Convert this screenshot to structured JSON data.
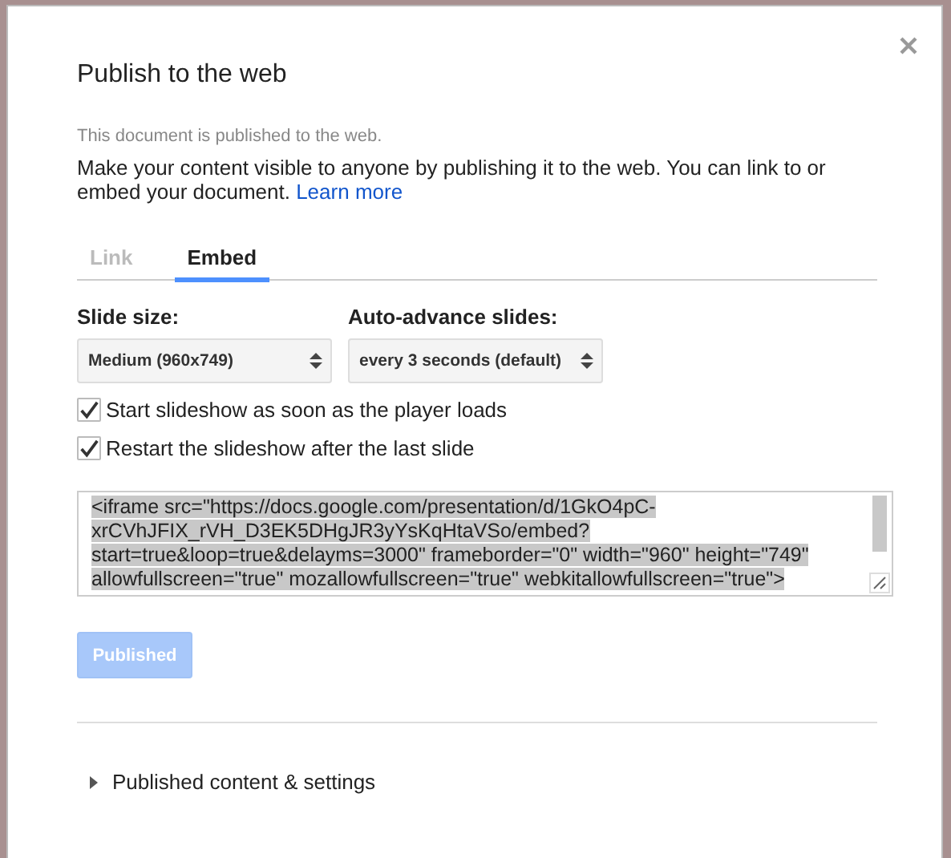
{
  "dialog": {
    "title": "Publish to the web",
    "status": "This document is published to the web.",
    "description": "Make your content visible to anyone by publishing it to the web. You can link to or embed your document.",
    "learn_more": "Learn more"
  },
  "tabs": [
    {
      "label": "Link",
      "selected": false,
      "disabled": true
    },
    {
      "label": "Embed",
      "selected": true,
      "disabled": false
    }
  ],
  "selects": [
    {
      "label": "Slide size:",
      "value": "Medium (960x749)"
    },
    {
      "label": "Auto-advance slides:",
      "value": "every 3 seconds (default)"
    }
  ],
  "options": [
    {
      "label": "Start slideshow as soon as the player loads",
      "checked": true
    },
    {
      "label": "Restart the slideshow after the last slide",
      "checked": true
    }
  ],
  "embed_code_lines": [
    "<iframe src=\"https://docs.google.com/presentation/d/1GkO4pC-",
    "xrCVhJFIX_rVH_D3EK5DHgJR3yYsKqHtaVSo/embed?",
    "start=true&loop=true&delayms=3000\" frameborder=\"0\" width=\"960\" height=\"749\"",
    "allowfullscreen=\"true\" mozallowfullscreen=\"true\" webkitallowfullscreen=\"true\">"
  ],
  "publish_button": {
    "label": "Published",
    "disabled": true
  },
  "section": {
    "label": "Published content & settings",
    "expanded": false
  }
}
